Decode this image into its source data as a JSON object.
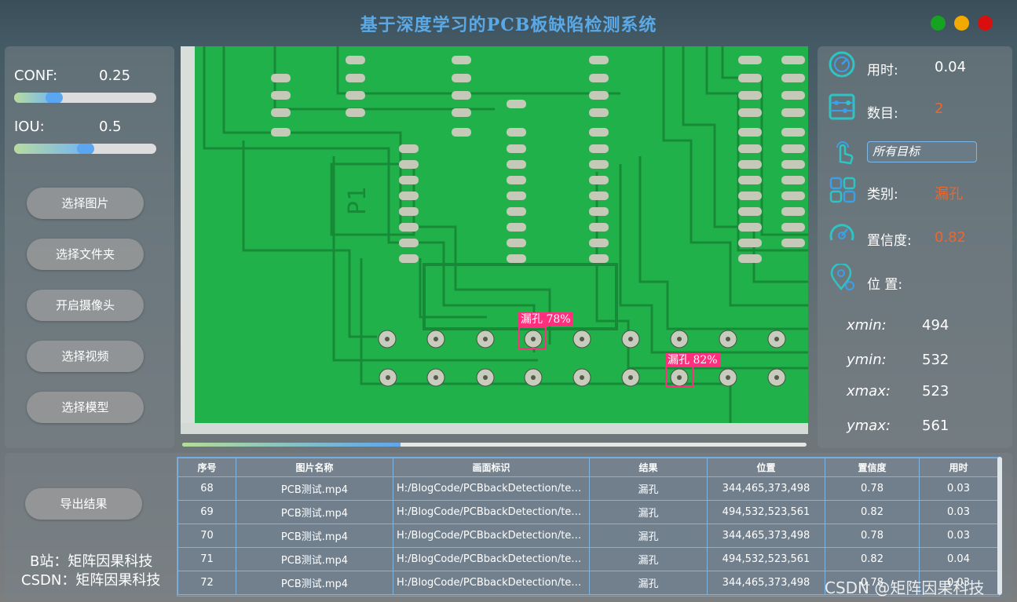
{
  "window": {
    "title": "基于深度学习的PCB板缺陷检测系统",
    "controls": [
      {
        "name": "maximize",
        "color": "#17a322"
      },
      {
        "name": "minimize",
        "color": "#f2a900"
      },
      {
        "name": "close",
        "color": "#d90f0f"
      }
    ]
  },
  "params": {
    "conf_label": "CONF:",
    "conf_value": "0.25",
    "conf_level": 0.25,
    "iou_label": "IOU:",
    "iou_value": "0.5",
    "iou_level": 0.5
  },
  "buttons": {
    "select_image": "选择图片",
    "select_folder": "选择文件夹",
    "open_camera": "开启摄像头",
    "select_video": "选择视频",
    "select_model": "选择模型",
    "export": "导出结果"
  },
  "detections": [
    {
      "label": "漏孔 78%"
    },
    {
      "label": "漏孔 82%"
    }
  ],
  "progress": 0.35,
  "result": {
    "time_label": "用时:",
    "time_value": "0.04",
    "count_label": "数目:",
    "count_value": "2",
    "target_select": "所有目标",
    "class_label": "类别:",
    "class_value": "漏孔",
    "conf_label": "置信度:",
    "conf_value": "0.82",
    "pos_label": "位 置:",
    "xmin_label": "xmin:",
    "xmin": "494",
    "ymin_label": "ymin:",
    "ymin": "532",
    "xmax_label": "xmax:",
    "xmax": "523",
    "ymax_label": "ymax:",
    "ymax": "561",
    "accent": "#f0652a"
  },
  "table": {
    "headers": [
      "序号",
      "图片名称",
      "画面标识",
      "结果",
      "位置",
      "置信度",
      "用时"
    ],
    "rows": [
      [
        "68",
        "PCB测试.mp4",
        "H:/BlogCode/PCBbackDetection/test...",
        "漏孔",
        "344,465,373,498",
        "0.78",
        "0.03"
      ],
      [
        "69",
        "PCB测试.mp4",
        "H:/BlogCode/PCBbackDetection/test...",
        "漏孔",
        "494,532,523,561",
        "0.82",
        "0.03"
      ],
      [
        "70",
        "PCB测试.mp4",
        "H:/BlogCode/PCBbackDetection/test...",
        "漏孔",
        "344,465,373,498",
        "0.78",
        "0.03"
      ],
      [
        "71",
        "PCB测试.mp4",
        "H:/BlogCode/PCBbackDetection/test...",
        "漏孔",
        "494,532,523,561",
        "0.82",
        "0.04"
      ],
      [
        "72",
        "PCB测试.mp4",
        "H:/BlogCode/PCBbackDetection/test...",
        "漏孔",
        "344,465,373,498",
        "0.78",
        "0.03"
      ]
    ]
  },
  "credits": {
    "line1": "B站：矩阵因果科技",
    "line2": "CSDN：矩阵因果科技"
  },
  "watermark": "CSDN @矩阵因果科技"
}
